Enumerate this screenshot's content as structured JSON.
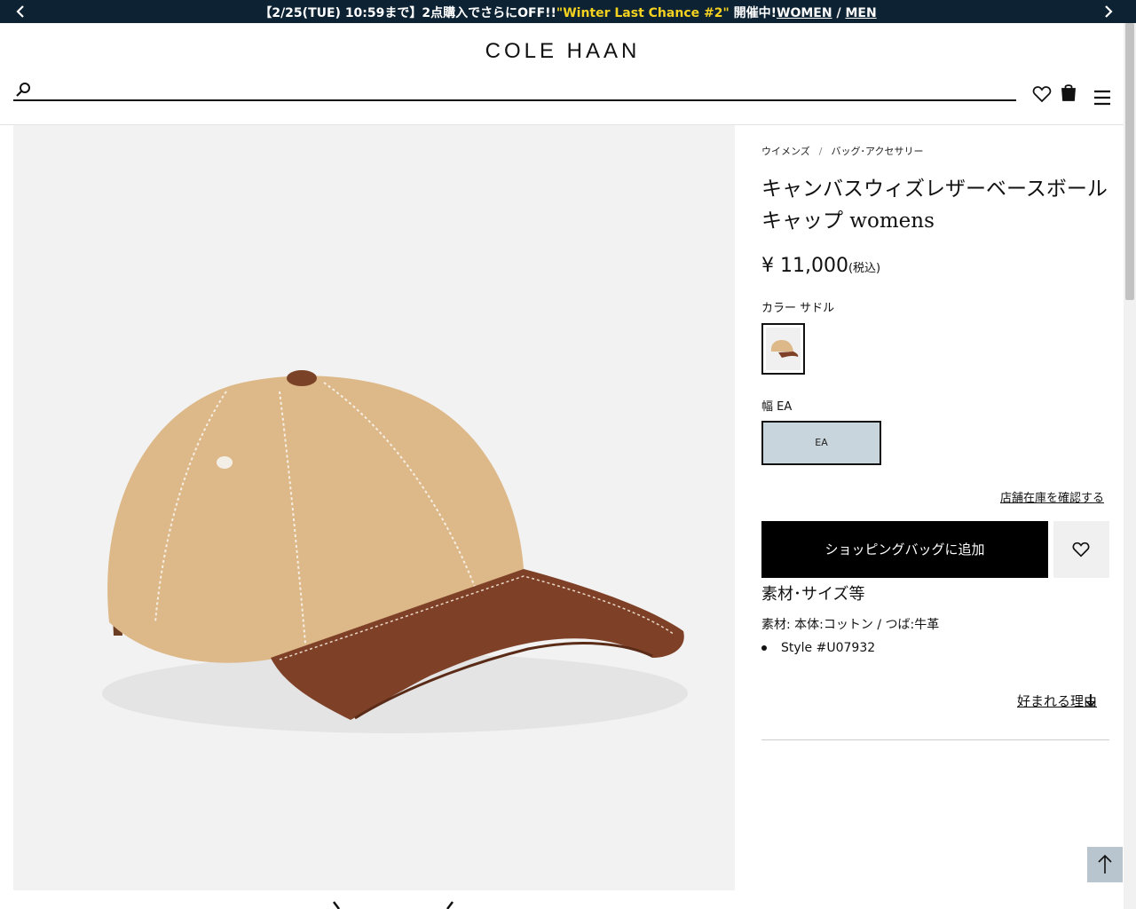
{
  "promo": {
    "prefix": "【2/25(TUE) 10:59まで】2点購入でさらにOFF!!",
    "highlight": "\"Winter Last Chance #2\"",
    "suffix": " 開催中!",
    "link_women": "WOMEN",
    "separator": " / ",
    "link_men": "MEN"
  },
  "header": {
    "logo": "COLE HAAN",
    "search_placeholder": "",
    "icons": [
      "search-icon",
      "heart-icon",
      "shopping-bag-icon",
      "hamburger-menu-icon"
    ]
  },
  "breadcrumb": {
    "items": [
      "ウイメンズ",
      "バッグ･アクセサリー"
    ],
    "separator": "/"
  },
  "product": {
    "title": "キャンバスウィズレザーベースボールキャップ womens",
    "price": "¥ 11,000",
    "tax_note": "(税込)",
    "color_label": "カラー サドル",
    "width_label": "幅 EA",
    "width_option": "EA",
    "stock_link": "店舗在庫を確認する",
    "add_to_bag": "ショッピングバッグに追加",
    "materials_title": "素材･サイズ等",
    "materials_text": "素材: 本体:コットン / つば:牛革",
    "style_number": "Style #U07932",
    "reason_link": "好まれる理由"
  },
  "colors": {
    "promo_bg": "#0d2233",
    "promo_highlight": "#f4d21f",
    "width_selected_bg": "#c9d5dc",
    "cta_bg": "#000000",
    "to_top_bg": "#b8c5ce"
  }
}
